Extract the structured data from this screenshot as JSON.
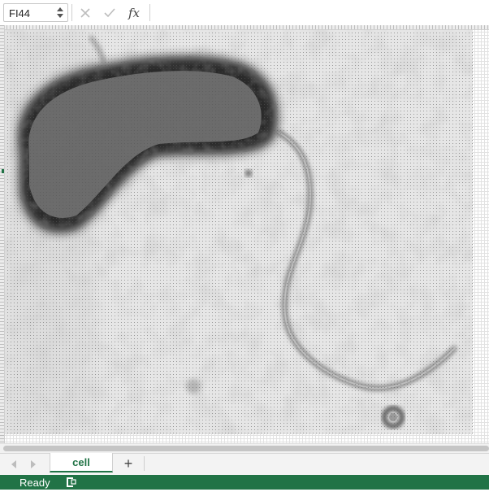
{
  "formula_bar": {
    "name_box": "FI44",
    "cancel_icon": "close-icon",
    "enter_icon": "check-icon",
    "fx_label": "fx",
    "formula_value": ""
  },
  "sheet": {
    "image_description_icon": "bacterium-micrograph",
    "tabs": [
      {
        "label": "cell",
        "active": true
      }
    ],
    "add_sheet_label": "+"
  },
  "status_bar": {
    "text": "Ready",
    "accent_color": "#217346"
  }
}
